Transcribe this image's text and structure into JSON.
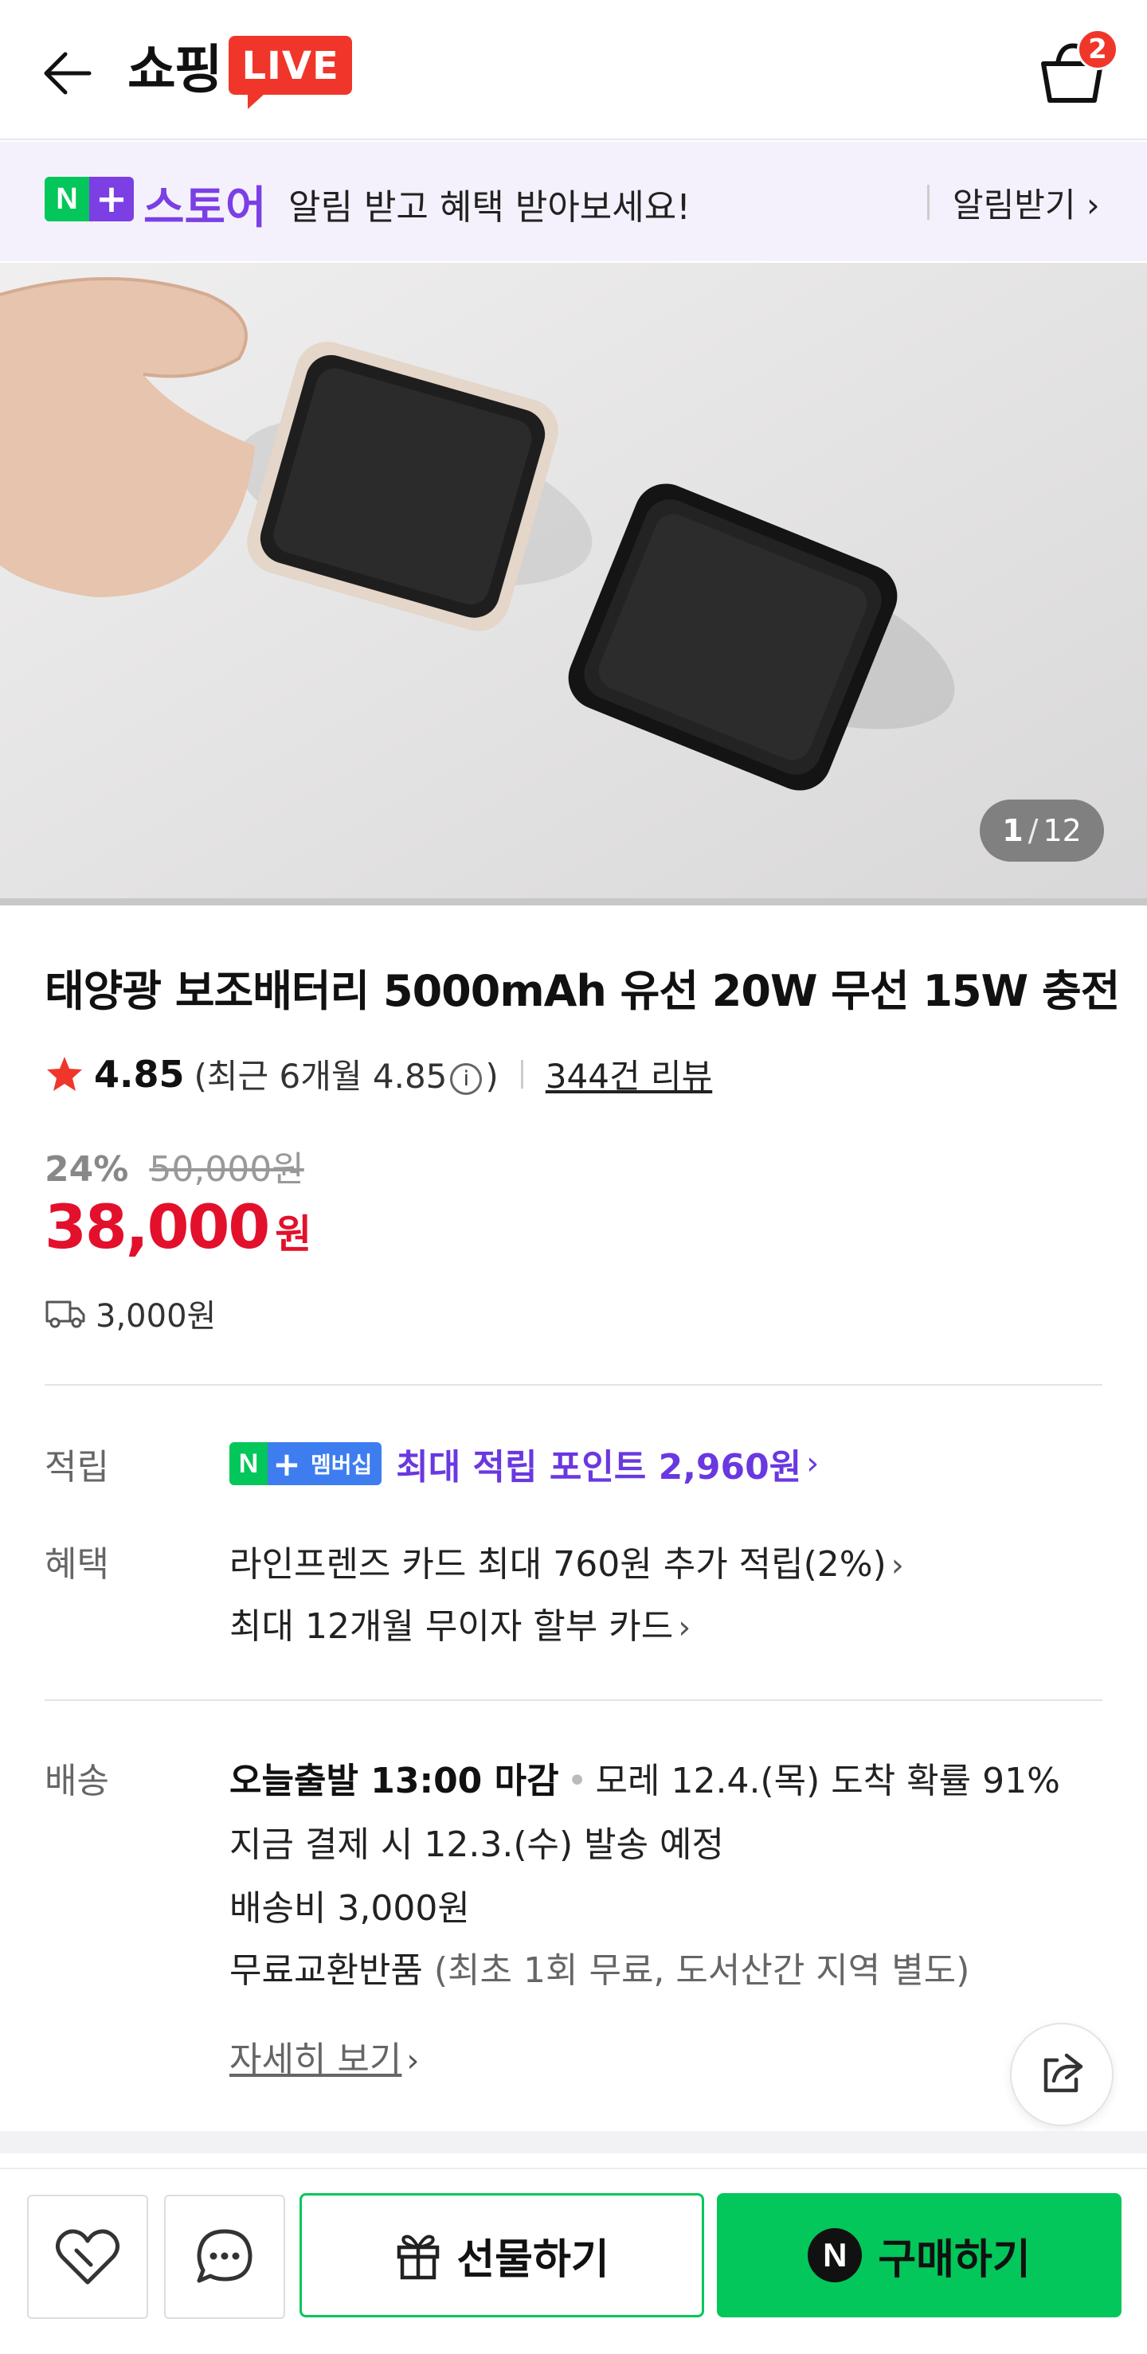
{
  "header": {
    "logo_text": "쇼핑",
    "live_badge": "LIVE",
    "cart_count": "2",
    "icons": {
      "back": "back-arrow-icon",
      "cart": "shopping-bag-icon"
    }
  },
  "store_banner": {
    "badge_n": "N",
    "badge_plus": "+",
    "store_name": "스토어",
    "message": "알림 받고 혜택 받아보세요!",
    "alarm_label": "알림받기",
    "chevron": "›"
  },
  "gallery": {
    "current": "1",
    "separator": "/",
    "total": "12"
  },
  "product": {
    "title": "태양광 보조배터리 5000mAh 유선 20W 무선 15W 충전",
    "rating": "4.85",
    "recent_rating_prefix": "(최근 6개월 4.85",
    "recent_rating_suffix": ")",
    "info_symbol": "i",
    "reviews": "344건 리뷰",
    "discount_rate": "24%",
    "original_price": "50,000원",
    "price": "38,000",
    "currency": "원",
    "shipping_fee": "3,000원"
  },
  "points": {
    "label": "적립",
    "badge_n": "N",
    "badge_plus": "+",
    "badge_member": "멤버십",
    "text": "최대 적립 포인트 2,960원",
    "chevron": "›"
  },
  "benefits": {
    "label": "혜택",
    "line1": "라인프렌즈 카드 최대 760원 추가 적립(2%)",
    "line2": "최대 12개월 무이자 할부 카드",
    "chevron": "›"
  },
  "delivery": {
    "label": "배송",
    "cutoff": "오늘출발 13:00 마감",
    "dot": "•",
    "arrival": "모레 12.4.(목) 도착 확률 91%",
    "dispatch": "지금 결제 시 12.3.(수) 발송 예정",
    "fee": "배송비 3,000원",
    "returns_label": "무료교환반품",
    "returns_note": "(최초 1회 무료, 도서산간 지역 별도)",
    "more_link": "자세히 보기",
    "chevron": "›"
  },
  "bottom_bar": {
    "gift_label": "선물하기",
    "buy_badge": "N",
    "buy_label": "구매하기",
    "icons": {
      "wish": "heart-icon",
      "chat": "chat-bubble-icon",
      "gift": "gift-icon",
      "share": "share-icon"
    }
  },
  "colors": {
    "accent_green": "#03c75a",
    "accent_purple": "#7b3fe4",
    "price_red": "#e3102c",
    "live_red": "#f0362a"
  }
}
